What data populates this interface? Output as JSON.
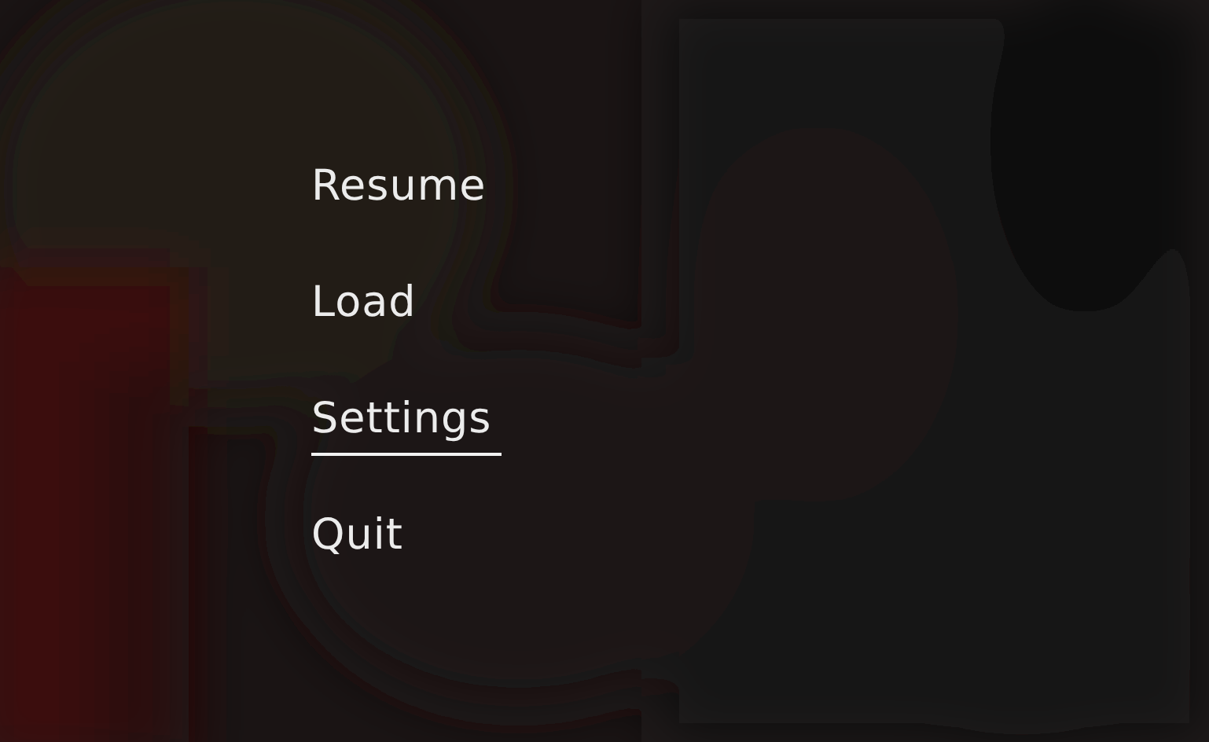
{
  "menu": {
    "items": [
      {
        "label": "Resume",
        "selected": false
      },
      {
        "label": "Load",
        "selected": false
      },
      {
        "label": "Settings",
        "selected": true
      },
      {
        "label": "Quit",
        "selected": false
      }
    ]
  }
}
